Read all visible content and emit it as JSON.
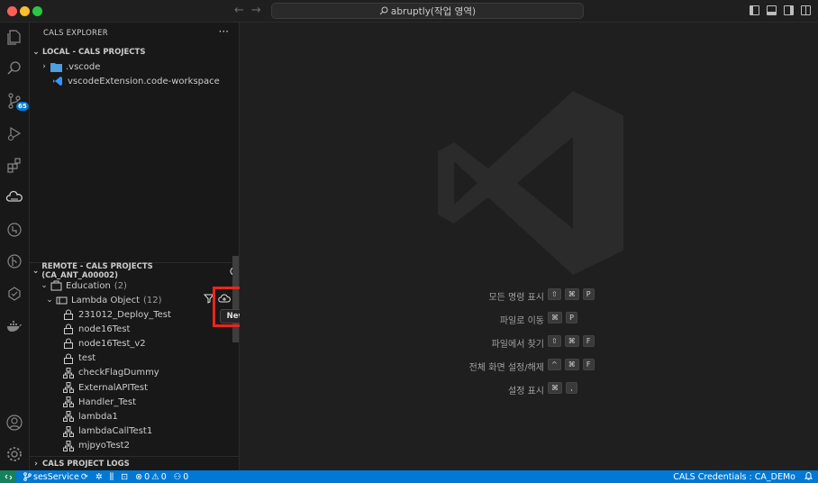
{
  "titlebar": {
    "search_text": "abruptly(작업 영역)"
  },
  "activity_bar": {
    "source_control_badge": "65"
  },
  "sidebar": {
    "title": "CALS EXPLORER",
    "more_label": "···",
    "local_section": {
      "title": "LOCAL - CALS PROJECTS",
      "items": [
        {
          "label": ".vscode",
          "type": "folder"
        },
        {
          "label": "vscodeExtension.code-workspace",
          "type": "workspace"
        }
      ]
    },
    "remote_section": {
      "title": "REMOTE - CALS PROJECTS (CA_ANT_A00002)",
      "education": {
        "label": "Education",
        "count": "(2)"
      },
      "lambda_object": {
        "label": "Lambda Object",
        "count": "(12)"
      },
      "items": [
        {
          "label": "231012_Deploy_Test",
          "icon": "lock-icon"
        },
        {
          "label": "node16Test",
          "icon": "lock-icon"
        },
        {
          "label": "node16Test_v2",
          "icon": "lock-icon"
        },
        {
          "label": "test",
          "icon": "lock-icon"
        },
        {
          "label": "checkFlagDummy",
          "icon": "org-icon"
        },
        {
          "label": "ExternalAPITest",
          "icon": "org-icon"
        },
        {
          "label": "Handler_Test",
          "icon": "org-icon"
        },
        {
          "label": "lambda1",
          "icon": "org-icon"
        },
        {
          "label": "lambdaCallTest1",
          "icon": "org-icon"
        },
        {
          "label": "mjpyoTest2",
          "icon": "org-icon"
        }
      ]
    },
    "logs_section": {
      "title": "CALS PROJECT LOGS"
    },
    "tooltip": "New"
  },
  "editor": {
    "shortcuts": [
      {
        "label": "모든 명령 표시",
        "keys": [
          "⇧",
          "⌘",
          "P"
        ]
      },
      {
        "label": "파일로 이동",
        "keys": [
          "⌘",
          "P"
        ]
      },
      {
        "label": "파일에서 찾기",
        "keys": [
          "⇧",
          "⌘",
          "F"
        ]
      },
      {
        "label": "전체 화면 설정/해제",
        "keys": [
          "^",
          "⌘",
          "F"
        ]
      },
      {
        "label": "설정 표시",
        "keys": [
          "⌘",
          ","
        ]
      }
    ]
  },
  "statusbar": {
    "service": "sesService",
    "errors": "0",
    "warnings": "0",
    "ports": "0",
    "credentials": "CALS Credentials : CA_DEMo"
  },
  "colors": {
    "accent": "#0078d4",
    "highlight": "#e8261d",
    "remote": "#16825d"
  }
}
